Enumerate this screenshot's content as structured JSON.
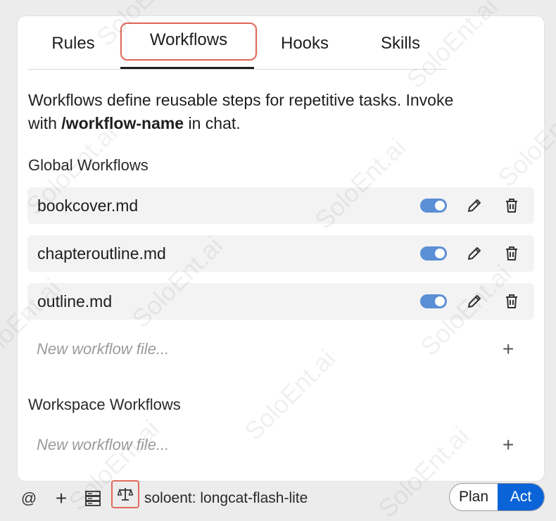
{
  "tabs": [
    {
      "label": "Rules"
    },
    {
      "label": "Workflows",
      "active": true
    },
    {
      "label": "Hooks"
    },
    {
      "label": "Skills"
    }
  ],
  "description": {
    "part1": "Workflows define reusable steps for repetitive tasks. Invoke",
    "part2_prefix": "with ",
    "command": "/workflow-name",
    "part2_suffix": " in chat."
  },
  "global": {
    "title": "Global Workflows",
    "items": [
      {
        "name": "bookcover.md",
        "enabled": true
      },
      {
        "name": "chapteroutline.md",
        "enabled": true
      },
      {
        "name": "outline.md",
        "enabled": true
      }
    ],
    "new_placeholder": "New workflow file...",
    "add_icon": "+"
  },
  "workspace": {
    "title": "Workspace Workflows",
    "new_placeholder": "New workflow file...",
    "add_icon": "+"
  },
  "bottombar": {
    "at": "@",
    "plus": "+",
    "server_icon": "server-icon",
    "scale_icon": "scale-icon",
    "model": "soloent: longcat-flash-lite",
    "mode_plan": "Plan",
    "mode_act": "Act",
    "active_mode": "Act"
  },
  "watermark": "SoloEnt.ai",
  "colors": {
    "accent": "#0b63d8",
    "toggle": "#5b8fd6",
    "highlight": "#e06a5c"
  }
}
